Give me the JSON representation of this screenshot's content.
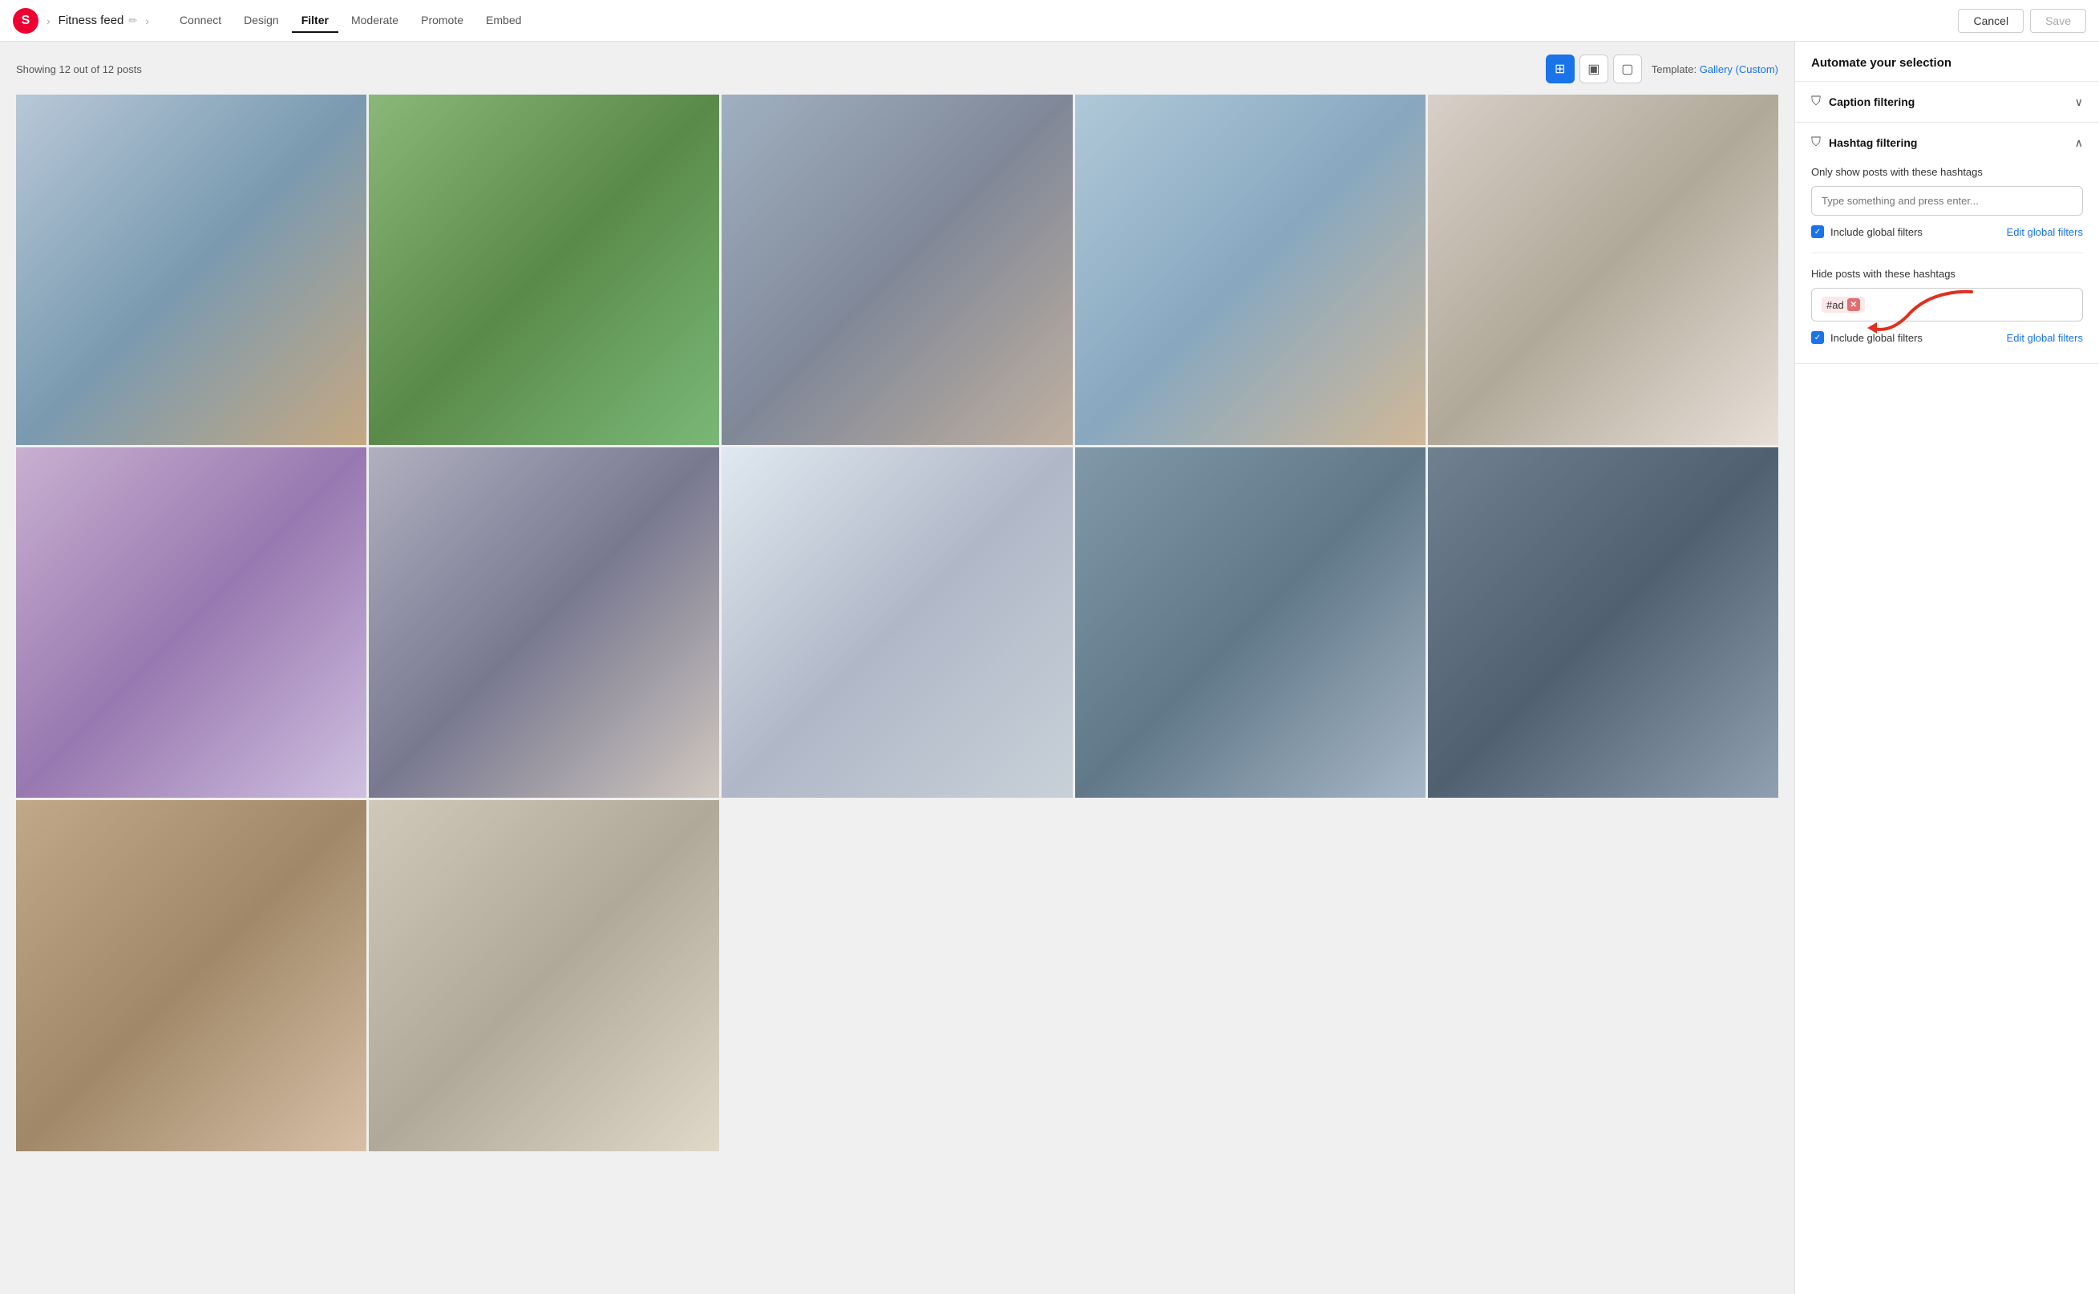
{
  "app": {
    "logo_letter": "S",
    "breadcrumb": "Fitness feed"
  },
  "nav": {
    "links": [
      {
        "id": "connect",
        "label": "Connect",
        "active": false
      },
      {
        "id": "design",
        "label": "Design",
        "active": false
      },
      {
        "id": "filter",
        "label": "Filter",
        "active": true
      },
      {
        "id": "moderate",
        "label": "Moderate",
        "active": false
      },
      {
        "id": "promote",
        "label": "Promote",
        "active": false
      },
      {
        "id": "embed",
        "label": "Embed",
        "active": false
      }
    ],
    "cancel_label": "Cancel",
    "save_label": "Save"
  },
  "toolbar": {
    "showing_text": "Showing 12 out of 12 posts",
    "template_label": "Template:",
    "template_value": "Gallery (Custom)"
  },
  "right_panel": {
    "header": "Automate your selection",
    "caption_filter": {
      "title": "Caption filtering",
      "expanded": false
    },
    "hashtag_filter": {
      "title": "Hashtag filtering",
      "expanded": true,
      "show_section": {
        "label": "Only show posts with these hashtags",
        "input_placeholder": "Type something and press enter...",
        "include_global_label": "Include global filters",
        "edit_global_label": "Edit global filters"
      },
      "hide_section": {
        "label": "Hide posts with these hashtags",
        "tag": "#ad",
        "include_global_label": "Include global filters",
        "edit_global_label": "Edit global filters"
      }
    }
  }
}
